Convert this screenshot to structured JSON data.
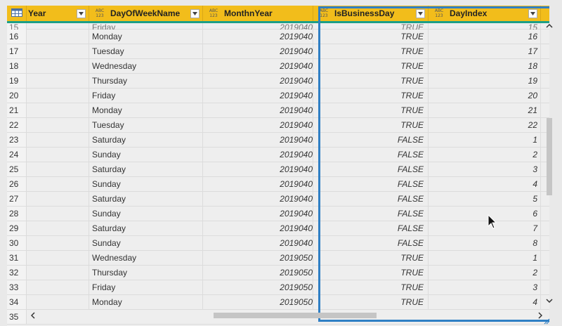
{
  "columns": {
    "year": {
      "label": "Year",
      "type_icon": "123"
    },
    "day_of_week": {
      "label": "DayOfWeekName",
      "type_icon": "ABC 123"
    },
    "month_year": {
      "label": "MonthnYear",
      "type_icon": "ABC 123"
    },
    "is_business_day": {
      "label": "IsBusinessDay",
      "type_icon": "ABC 123"
    },
    "day_index": {
      "label": "DayIndex",
      "type_icon": "ABC 123"
    }
  },
  "top_partial_row": {
    "index": "15",
    "day": "Friday",
    "month": "2019040",
    "biz": "TRUE",
    "dix": "15"
  },
  "rows": [
    {
      "index": "16",
      "day": "Monday",
      "month": "2019040",
      "biz": "TRUE",
      "dix": "16"
    },
    {
      "index": "17",
      "day": "Tuesday",
      "month": "2019040",
      "biz": "TRUE",
      "dix": "17"
    },
    {
      "index": "18",
      "day": "Wednesday",
      "month": "2019040",
      "biz": "TRUE",
      "dix": "18"
    },
    {
      "index": "19",
      "day": "Thursday",
      "month": "2019040",
      "biz": "TRUE",
      "dix": "19"
    },
    {
      "index": "20",
      "day": "Friday",
      "month": "2019040",
      "biz": "TRUE",
      "dix": "20"
    },
    {
      "index": "21",
      "day": "Monday",
      "month": "2019040",
      "biz": "TRUE",
      "dix": "21"
    },
    {
      "index": "22",
      "day": "Tuesday",
      "month": "2019040",
      "biz": "TRUE",
      "dix": "22"
    },
    {
      "index": "23",
      "day": "Saturday",
      "month": "2019040",
      "biz": "FALSE",
      "dix": "1"
    },
    {
      "index": "24",
      "day": "Sunday",
      "month": "2019040",
      "biz": "FALSE",
      "dix": "2"
    },
    {
      "index": "25",
      "day": "Saturday",
      "month": "2019040",
      "biz": "FALSE",
      "dix": "3"
    },
    {
      "index": "26",
      "day": "Sunday",
      "month": "2019040",
      "biz": "FALSE",
      "dix": "4"
    },
    {
      "index": "27",
      "day": "Saturday",
      "month": "2019040",
      "biz": "FALSE",
      "dix": "5"
    },
    {
      "index": "28",
      "day": "Sunday",
      "month": "2019040",
      "biz": "FALSE",
      "dix": "6"
    },
    {
      "index": "29",
      "day": "Saturday",
      "month": "2019040",
      "biz": "FALSE",
      "dix": "7"
    },
    {
      "index": "30",
      "day": "Sunday",
      "month": "2019040",
      "biz": "FALSE",
      "dix": "8"
    },
    {
      "index": "31",
      "day": "Wednesday",
      "month": "2019050",
      "biz": "TRUE",
      "dix": "1"
    },
    {
      "index": "32",
      "day": "Thursday",
      "month": "2019050",
      "biz": "TRUE",
      "dix": "2"
    },
    {
      "index": "33",
      "day": "Friday",
      "month": "2019050",
      "biz": "TRUE",
      "dix": "3"
    },
    {
      "index": "34",
      "day": "Monday",
      "month": "2019050",
      "biz": "TRUE",
      "dix": "4"
    }
  ],
  "bottom_partial_row": {
    "index": "35"
  },
  "icons": {
    "table_menu": "table-grid-icon",
    "dropdown": "chevron-down-icon",
    "scroll_up": "chevron-up-icon",
    "scroll_down": "chevron-down-icon",
    "scroll_left": "chevron-left-icon",
    "scroll_right": "chevron-right-icon"
  },
  "colors": {
    "header": "#f2bd1b",
    "header_underline": "#1c9f87",
    "selection_border": "#2f7fc4"
  }
}
